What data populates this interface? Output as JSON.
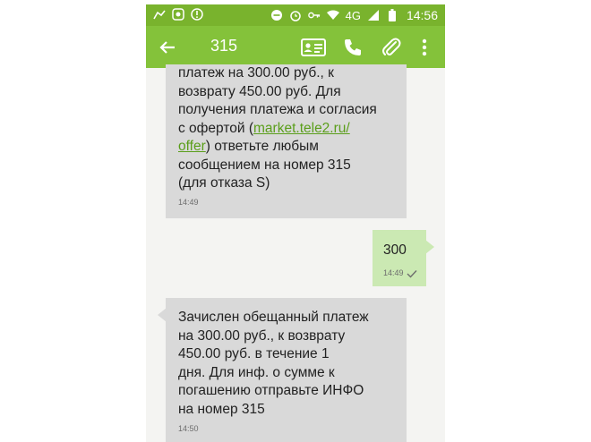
{
  "status_bar": {
    "network_type": "4G",
    "time": "14:56",
    "left_icons": [
      "android-debug-icon",
      "app-icon",
      "shield-alert-icon"
    ],
    "right_icons": [
      "minus-circle-icon",
      "alarm-icon",
      "key-icon",
      "wifi-icon",
      "signal-icon",
      "battery-icon"
    ]
  },
  "toolbar": {
    "title": "315",
    "accent_color": "#84c23a"
  },
  "messages": [
    {
      "direction": "incoming",
      "lines": [
        "платеж на 300.00 руб., к",
        "возврату 450.00 руб. Для",
        "получения платежа и согласия"
      ],
      "line4_prefix": "с офертой (",
      "link_part1": "market.tele2.ru/",
      "link_part2": "offer",
      "line5_suffix": ") ответьте любым",
      "lines_after": [
        "сообщением на номер 315",
        "(для отказа S)"
      ],
      "time": "14:49"
    },
    {
      "direction": "outgoing",
      "text": "300",
      "time": "14:49",
      "status": "delivered-check"
    },
    {
      "direction": "incoming",
      "text": "Зачислен обещанный платеж\nна 300.00 руб., к возврату\n450.00 руб. в течение 1\nдня. Для инф. о сумме к\nпогашению отправьте ИНФО\nна номер 315",
      "time": "14:50"
    }
  ]
}
